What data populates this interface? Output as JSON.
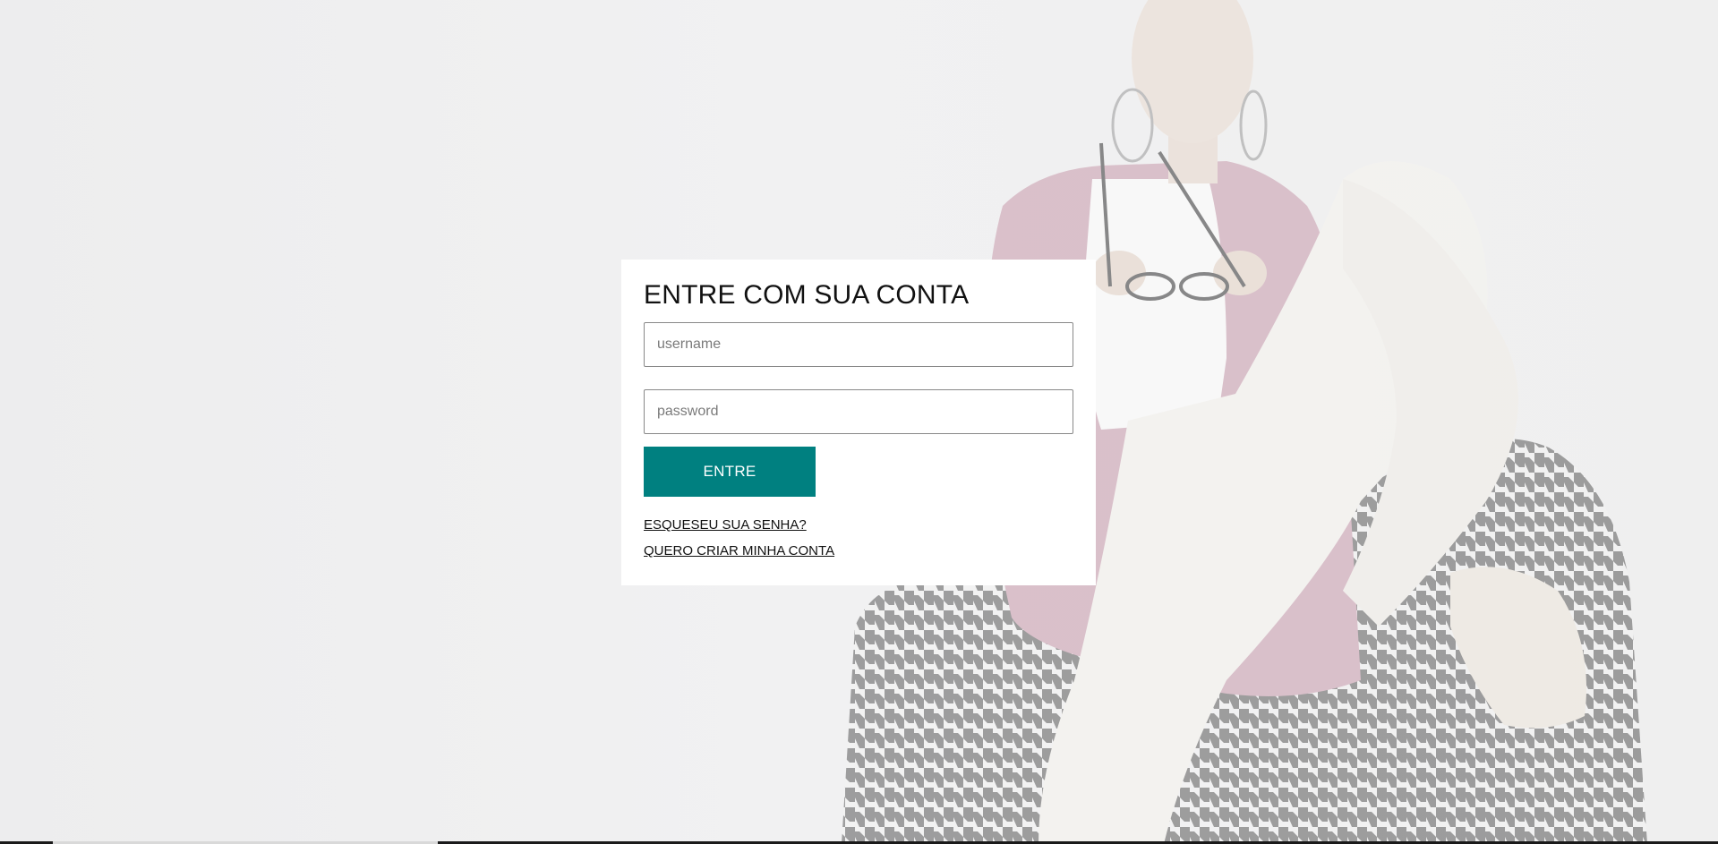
{
  "login": {
    "title": "ENTRE COM SUA CONTA",
    "username_placeholder": "username",
    "password_placeholder": "password",
    "submit_label": "ENTRE",
    "forgot_link": "ESQUESEU SUA SENHA?",
    "create_account_link": "QUERO CRIAR MINHA CONTA"
  },
  "colors": {
    "accent": "#008080",
    "card_background": "#ffffff",
    "page_background": "#efeff0"
  },
  "background": {
    "image": "woman-sitting-on-houndstooth-chair-photo"
  }
}
